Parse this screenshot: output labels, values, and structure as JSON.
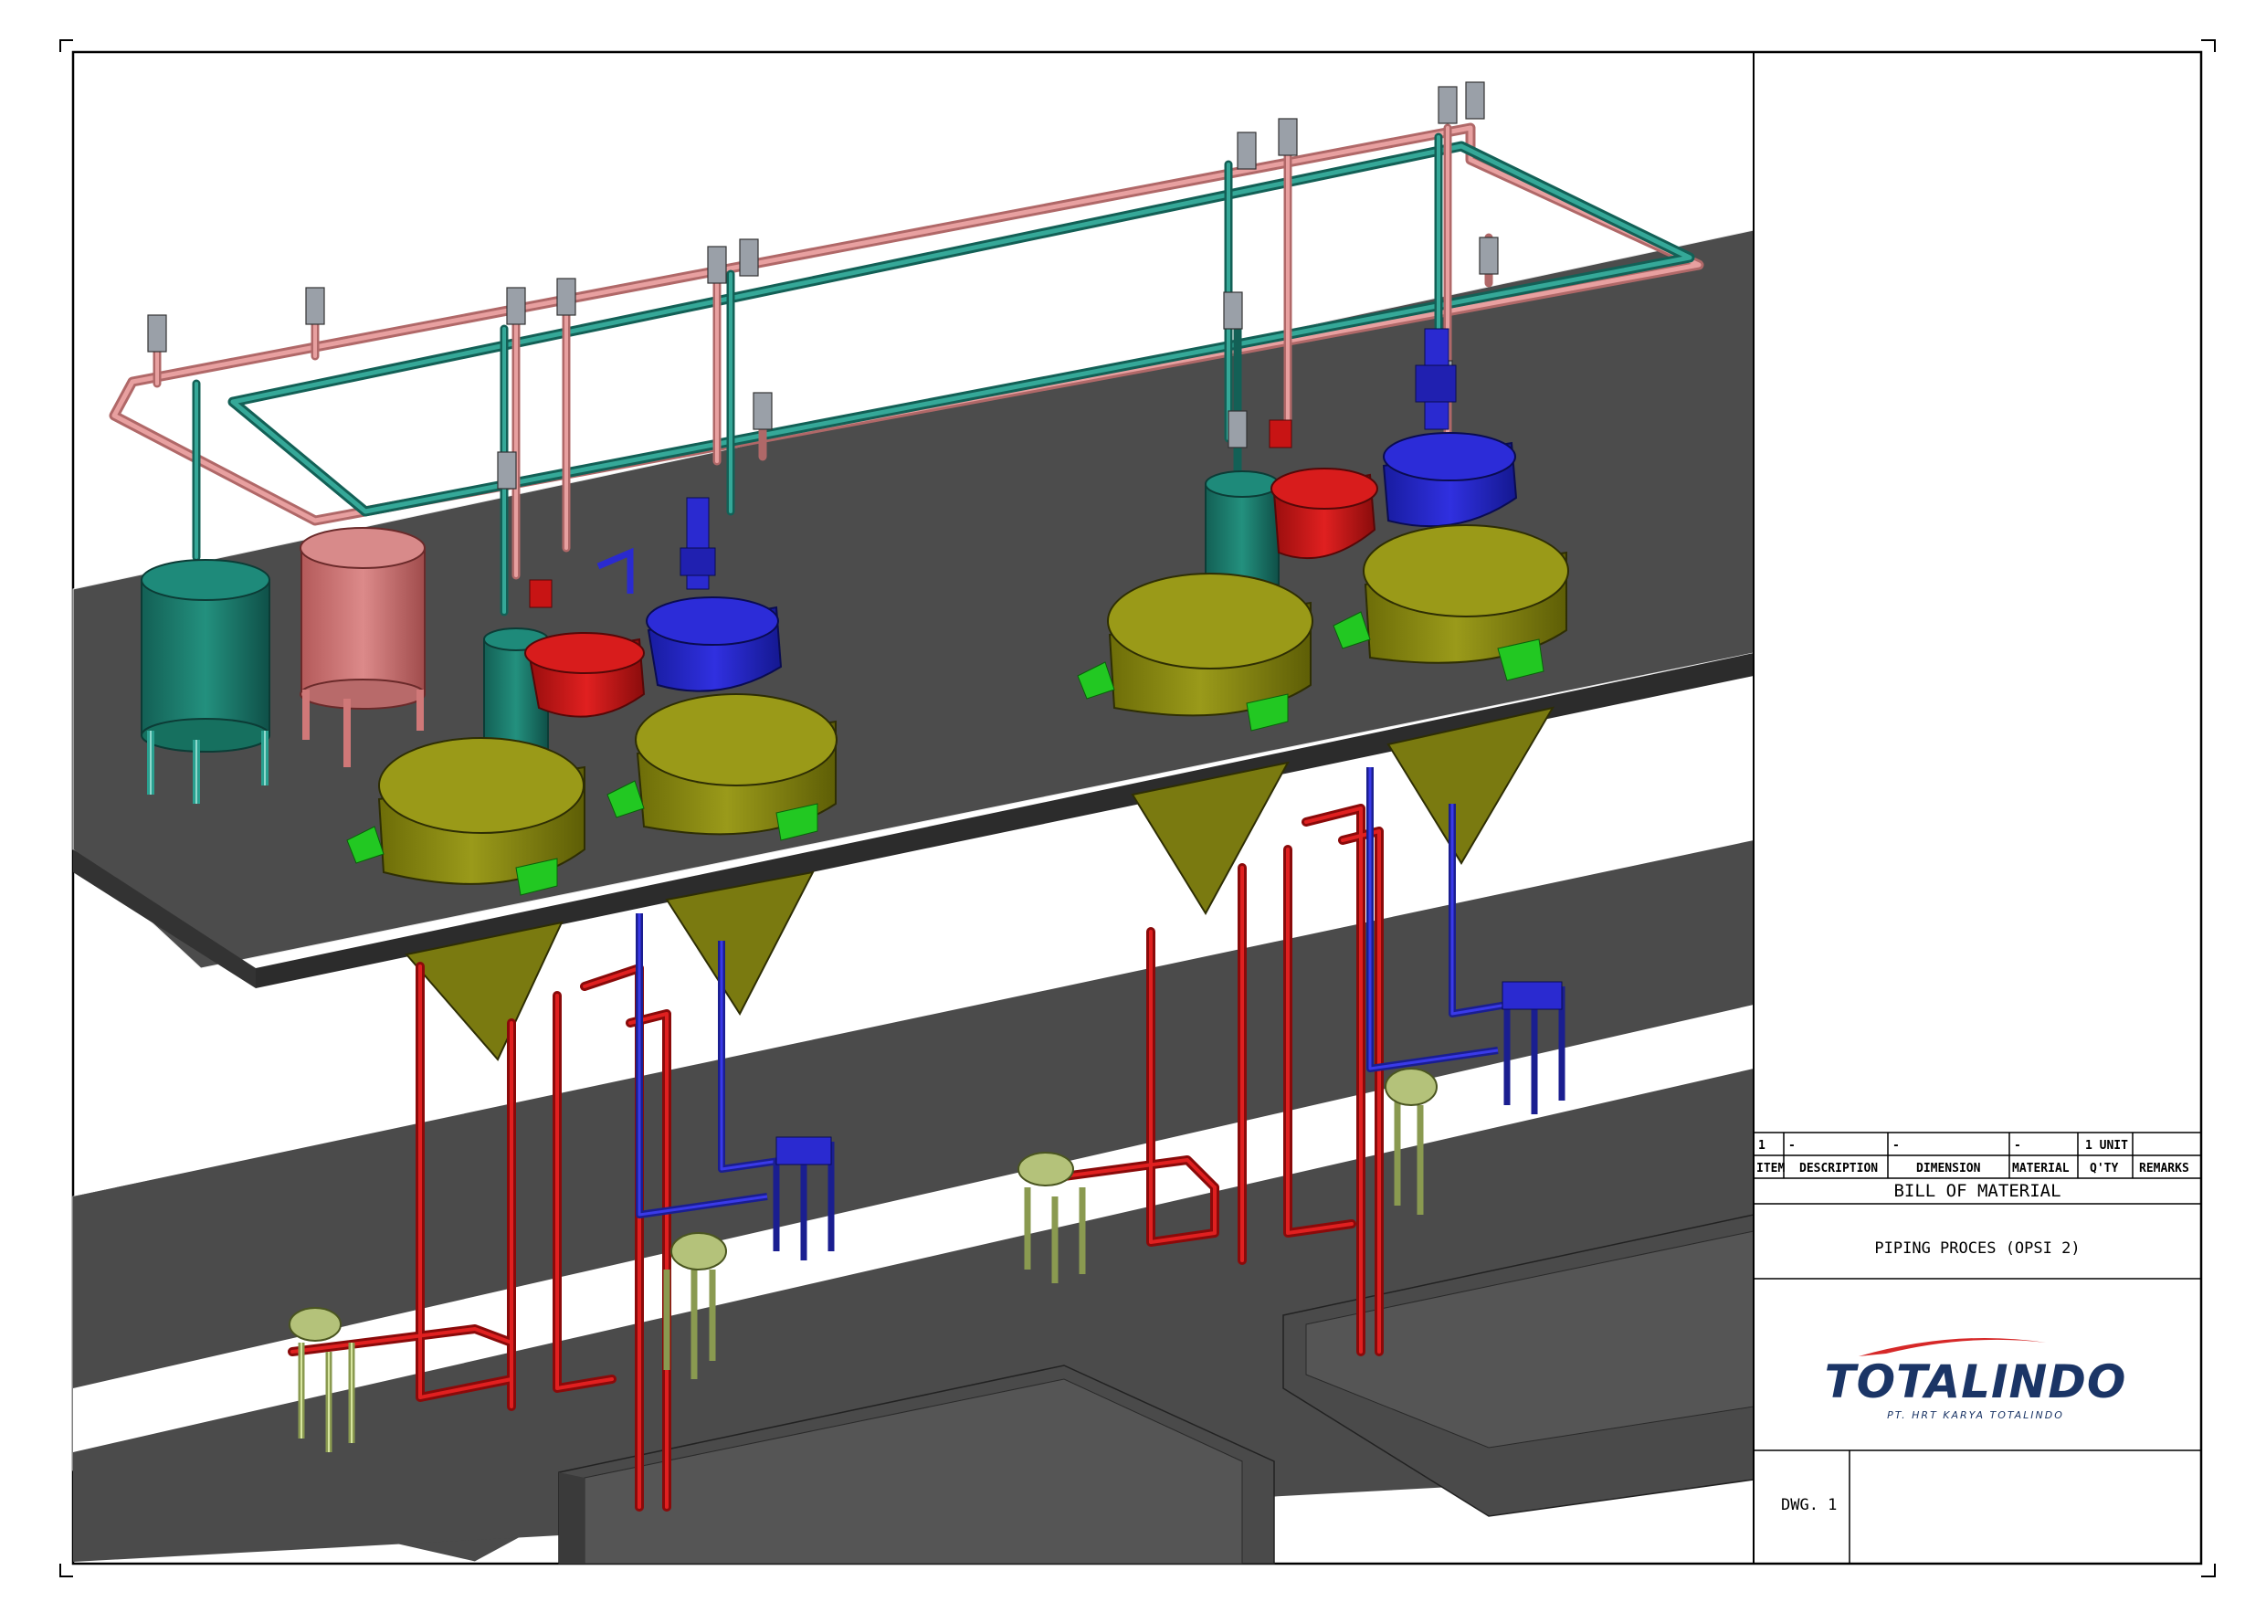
{
  "bill_of_material": {
    "title": "BILL OF MATERIAL",
    "headers": [
      "ITEM",
      "DESCRIPTION",
      "DIMENSION",
      "MATERIAL",
      "Q'TY",
      "REMARKS"
    ],
    "rows": [
      [
        "1",
        "-",
        "-",
        "-",
        "1 UNIT",
        ""
      ]
    ]
  },
  "project_title": "PIPING PROCES (OPSI 2)",
  "company": {
    "logo_text": "TOTALINDO",
    "subtitle": "PT. HRT KARYA TOTALINDO"
  },
  "drawing_number": "DWG. 1",
  "colors": {
    "platform": "#4a4a4a",
    "platform_edge": "#2e2e2e",
    "pipe_red": "#c81414",
    "pipe_pink": "#d08080",
    "pipe_teal": "#1f8a80",
    "pipe_blue": "#1f28c8",
    "tank_olive": "#8a8a10",
    "tank_red": "#cc1818",
    "tank_blue": "#2a2ad0",
    "tank_teal": "#1a8070",
    "tank_pink": "#d07070",
    "support_green": "#22c822",
    "pump_frame": "#b0c070",
    "logo_blue": "#1b3566",
    "logo_red": "#d62828"
  }
}
